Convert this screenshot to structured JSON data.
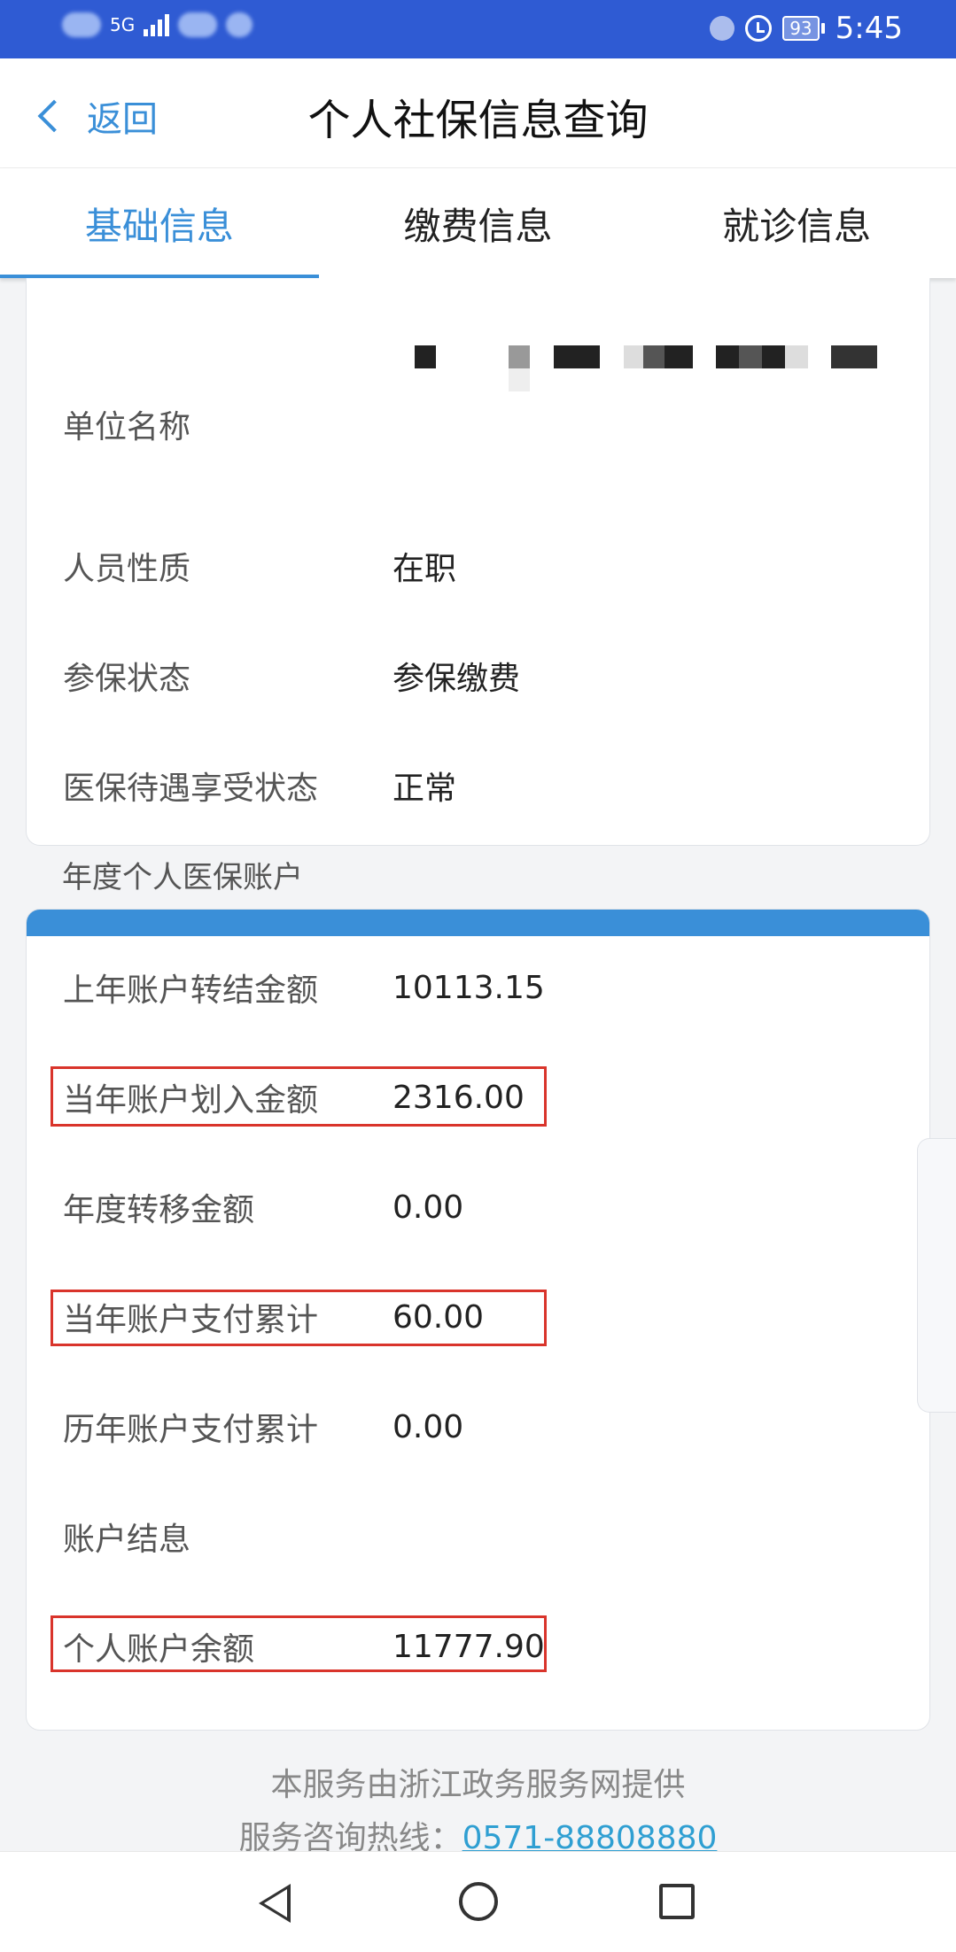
{
  "status_bar": {
    "network": "5G",
    "battery": "93",
    "time": "5:45",
    "bg_color": "#2f5bd3"
  },
  "header": {
    "back_label": "返回",
    "title": "个人社保信息查询"
  },
  "tabs": [
    {
      "label": "基础信息",
      "active": true
    },
    {
      "label": "缴费信息",
      "active": false
    },
    {
      "label": "就诊信息",
      "active": false
    }
  ],
  "basic_info": {
    "rows": [
      {
        "label": "单位名称",
        "value": ""
      },
      {
        "label": "人员性质",
        "value": "在职"
      },
      {
        "label": "参保状态",
        "value": "参保缴费"
      },
      {
        "label": "医保待遇享受状态",
        "value": "正常"
      }
    ]
  },
  "account_section_label": "年度个人医保账户",
  "account": {
    "rows": [
      {
        "label": "上年账户转结金额",
        "value": "10113.15",
        "highlighted": false
      },
      {
        "label": "当年账户划入金额",
        "value": "2316.00",
        "highlighted": true
      },
      {
        "label": "年度转移金额",
        "value": "0.00",
        "highlighted": false
      },
      {
        "label": "当年账户支付累计",
        "value": "60.00",
        "highlighted": true
      },
      {
        "label": "历年账户支付累计",
        "value": "0.00",
        "highlighted": false
      },
      {
        "label": "账户结息",
        "value": "",
        "highlighted": false
      },
      {
        "label": "个人账户余额",
        "value": "11777.90",
        "highlighted": true
      }
    ]
  },
  "footer": {
    "provider": "本服务由浙江政务服务网提供",
    "hotline_label": "服务咨询热线：",
    "hotline_number": "0571-88808880"
  },
  "colors": {
    "accent": "#3a8fd8",
    "highlight_border": "#d9342b"
  },
  "icons": [
    "signal-icon",
    "alarm-icon",
    "battery-icon",
    "chevron-left-icon",
    "nav-back-icon",
    "nav-home-icon",
    "nav-recent-icon"
  ]
}
